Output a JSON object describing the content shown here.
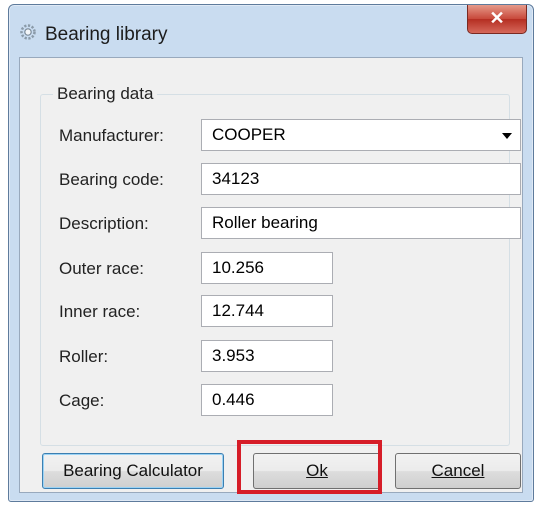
{
  "window": {
    "title": "Bearing library",
    "close_glyph": "✕"
  },
  "group": {
    "legend": "Bearing data"
  },
  "fields": {
    "manufacturer": {
      "label": "Manufacturer:",
      "value": "COOPER"
    },
    "bearing_code": {
      "label": "Bearing code:",
      "value": "34123"
    },
    "description": {
      "label": "Description:",
      "value": "Roller bearing"
    },
    "outer_race": {
      "label": "Outer race:",
      "value": "10.256"
    },
    "inner_race": {
      "label": "Inner race:",
      "value": "12.744"
    },
    "roller": {
      "label": "Roller:",
      "value": "3.953"
    },
    "cage": {
      "label": "Cage:",
      "value": "0.446"
    }
  },
  "buttons": {
    "calculator": "Bearing Calculator",
    "ok": "Ok",
    "cancel": "Cancel"
  },
  "colors": {
    "highlight": "#d61d28",
    "window_frame": "#c9dcf0",
    "client_bg": "#f0f0f0"
  },
  "icons": {
    "title_icon": "gear-icon",
    "close_icon": "close-icon",
    "dropdown_icon": "chevron-down-icon"
  }
}
